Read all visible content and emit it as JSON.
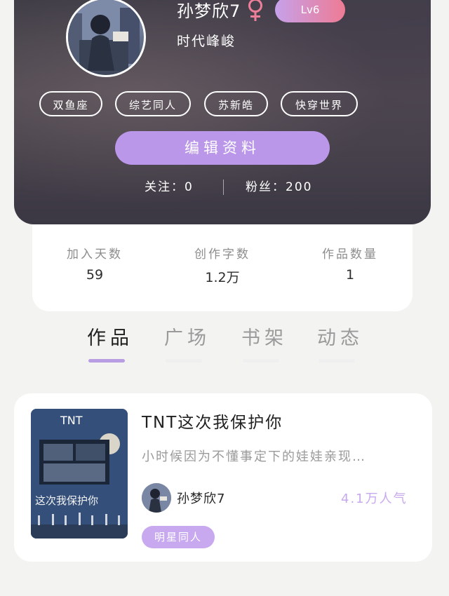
{
  "profile": {
    "username": "孙梦欣7",
    "level": "Lv6",
    "bio": "时代峰峻",
    "tags": [
      "双鱼座",
      "综艺同人",
      "苏新皓",
      "快穿世界"
    ],
    "edit_button": "编辑资料",
    "following": "关注：0",
    "followers": "粉丝：200"
  },
  "stats": [
    {
      "label": "加入天数",
      "value": "59"
    },
    {
      "label": "创作字数",
      "value": "1.2万"
    },
    {
      "label": "作品数量",
      "value": "1"
    }
  ],
  "tabs": [
    "作品",
    "广场",
    "书架",
    "动态"
  ],
  "work": {
    "cover_title": "TNT",
    "cover_caption": "这次我保护你",
    "title": "TNT这次我保护你",
    "description": "小时候因为不懂事定下的娃娃亲现…",
    "author": "孙梦欣7",
    "popularity": "4.1万人气",
    "genre": "明星同人"
  },
  "colors": {
    "accent": "#bb97e9",
    "level_badge_start": "#c6a1ea",
    "level_badge_end": "#ee7b94",
    "popularity": "#c7a9ee",
    "header_bg": "#45424b"
  },
  "icons": {
    "gender": "female-symbol-icon"
  }
}
